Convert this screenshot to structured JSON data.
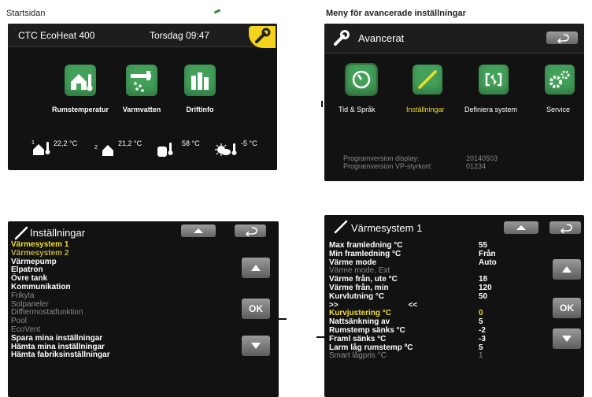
{
  "captions": {
    "left_top": "Startsidan",
    "right_top": "Meny för avancerade inställningar"
  },
  "home_screen": {
    "title": "CTC EcoHeat 400",
    "datetime": "Torsdag 09:47",
    "tiles": [
      {
        "label": "Rumstemperatur",
        "icon": "house-thermometer-icon"
      },
      {
        "label": "Varmvatten",
        "icon": "faucet-icon"
      },
      {
        "label": "Driftinfo",
        "icon": "bars-icon"
      }
    ],
    "stats": [
      {
        "index": "1",
        "value": "22,2 °C"
      },
      {
        "index": "2",
        "value": "21,2 °C"
      },
      {
        "index": "",
        "value": "58 °C"
      },
      {
        "index": "",
        "value": "-5 °C"
      }
    ]
  },
  "advanced_screen": {
    "title": "Avancerat",
    "items": [
      {
        "label": "Tid & Språk",
        "icon": "clock-icon",
        "active": false
      },
      {
        "label": "Inställningar",
        "icon": "screwdriver-icon",
        "active": true
      },
      {
        "label": "Definiera system",
        "icon": "define-system-icon",
        "active": false
      },
      {
        "label": "Service",
        "icon": "gears-icon",
        "active": false
      }
    ],
    "versions": [
      {
        "label": "Programversion display:",
        "value": "20140503"
      },
      {
        "label": "Programversion VP-styrkort:",
        "value": "01234"
      }
    ]
  },
  "settings_screen": {
    "title": "Inställningar",
    "items": [
      {
        "label": "Värmesystem 1",
        "style": "hl"
      },
      {
        "label": "Värmesystem 2",
        "style": "hl2"
      },
      {
        "label": "Värmepump",
        "style": ""
      },
      {
        "label": "Elpatron",
        "style": ""
      },
      {
        "label": "Övre tank",
        "style": ""
      },
      {
        "label": "Kommunikation",
        "style": ""
      },
      {
        "label": "Frikyla",
        "style": "dim"
      },
      {
        "label": "Solpaneler",
        "style": "dim"
      },
      {
        "label": "Difftermostatfunktion",
        "style": "dim"
      },
      {
        "label": "Pool",
        "style": "dim"
      },
      {
        "label": "EcoVent",
        "style": "dim"
      },
      {
        "label": "Spara mina inställningar",
        "style": ""
      },
      {
        "label": "Hämta mina inställningar",
        "style": ""
      },
      {
        "label": "Hämta fabriksinställningar",
        "style": ""
      }
    ],
    "ok_label": "OK"
  },
  "heating_screen": {
    "title": "Värmesystem 1",
    "rows": [
      {
        "label": "Max framledning °C",
        "value": "55",
        "style": ""
      },
      {
        "label": "Min framledning °C",
        "value": "Från",
        "style": ""
      },
      {
        "label": "Värme mode",
        "value": "Auto",
        "style": ""
      },
      {
        "label": "Värme mode, Ext",
        "value": "",
        "style": "dim"
      },
      {
        "label": "Värme från, ute °C",
        "value": "18",
        "style": ""
      },
      {
        "label": "Värme från, min",
        "value": "120",
        "style": ""
      },
      {
        "label": "Kurvlutning °C",
        "value": "50",
        "style": ""
      },
      {
        "label": ">>                                <<",
        "value": "",
        "style": ""
      },
      {
        "label": "Kurvjustering °C",
        "value": "0",
        "style": "hl"
      },
      {
        "label": "Nattsänkning av",
        "value": "5",
        "style": ""
      },
      {
        "label": "Rumstemp sänks °C",
        "value": "-2",
        "style": ""
      },
      {
        "label": "Framl sänks °C",
        "value": "-3",
        "style": ""
      },
      {
        "label": "Larm låg rumstemp ºC",
        "value": "5",
        "style": ""
      },
      {
        "label": "Smart lågpris °C",
        "value": "1",
        "style": "dim"
      }
    ],
    "ok_label": "OK"
  },
  "colors": {
    "screen_bg": "#121212",
    "tile_green": "#43a15a",
    "highlight_yellow": "#f3df22",
    "wrench_yellow": "#f4d31c"
  }
}
